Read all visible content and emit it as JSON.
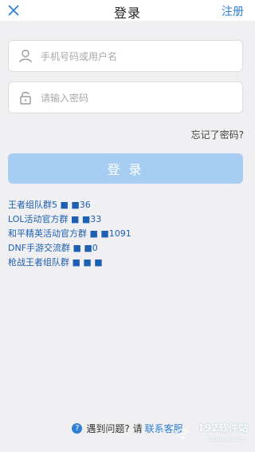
{
  "header": {
    "title": "登录",
    "register_label": "注册",
    "close_icon": "close-icon"
  },
  "form": {
    "username_placeholder": "手机号码或用户名",
    "password_placeholder": "请输入密码",
    "forgot_label": "忘记了密码?",
    "login_label": "登 录"
  },
  "groups": [
    "王者组队群5 ■ ■36",
    "LOL活动官方群 ■ ■33",
    "和平精英活动官方群 ■ ■1091",
    "DNF手游交流群 ■ ■0",
    "枪战王者组队群 ■ ■ ■"
  ],
  "help": {
    "question_text": "遇到问题? 请",
    "contact_label": "联系客服"
  },
  "watermark": {
    "text": "192软件站",
    "sub": "192luyou.com"
  },
  "colors": {
    "accent": "#2f7fd6",
    "login_button": "#a8cdf2",
    "background": "#f0f0f2"
  }
}
